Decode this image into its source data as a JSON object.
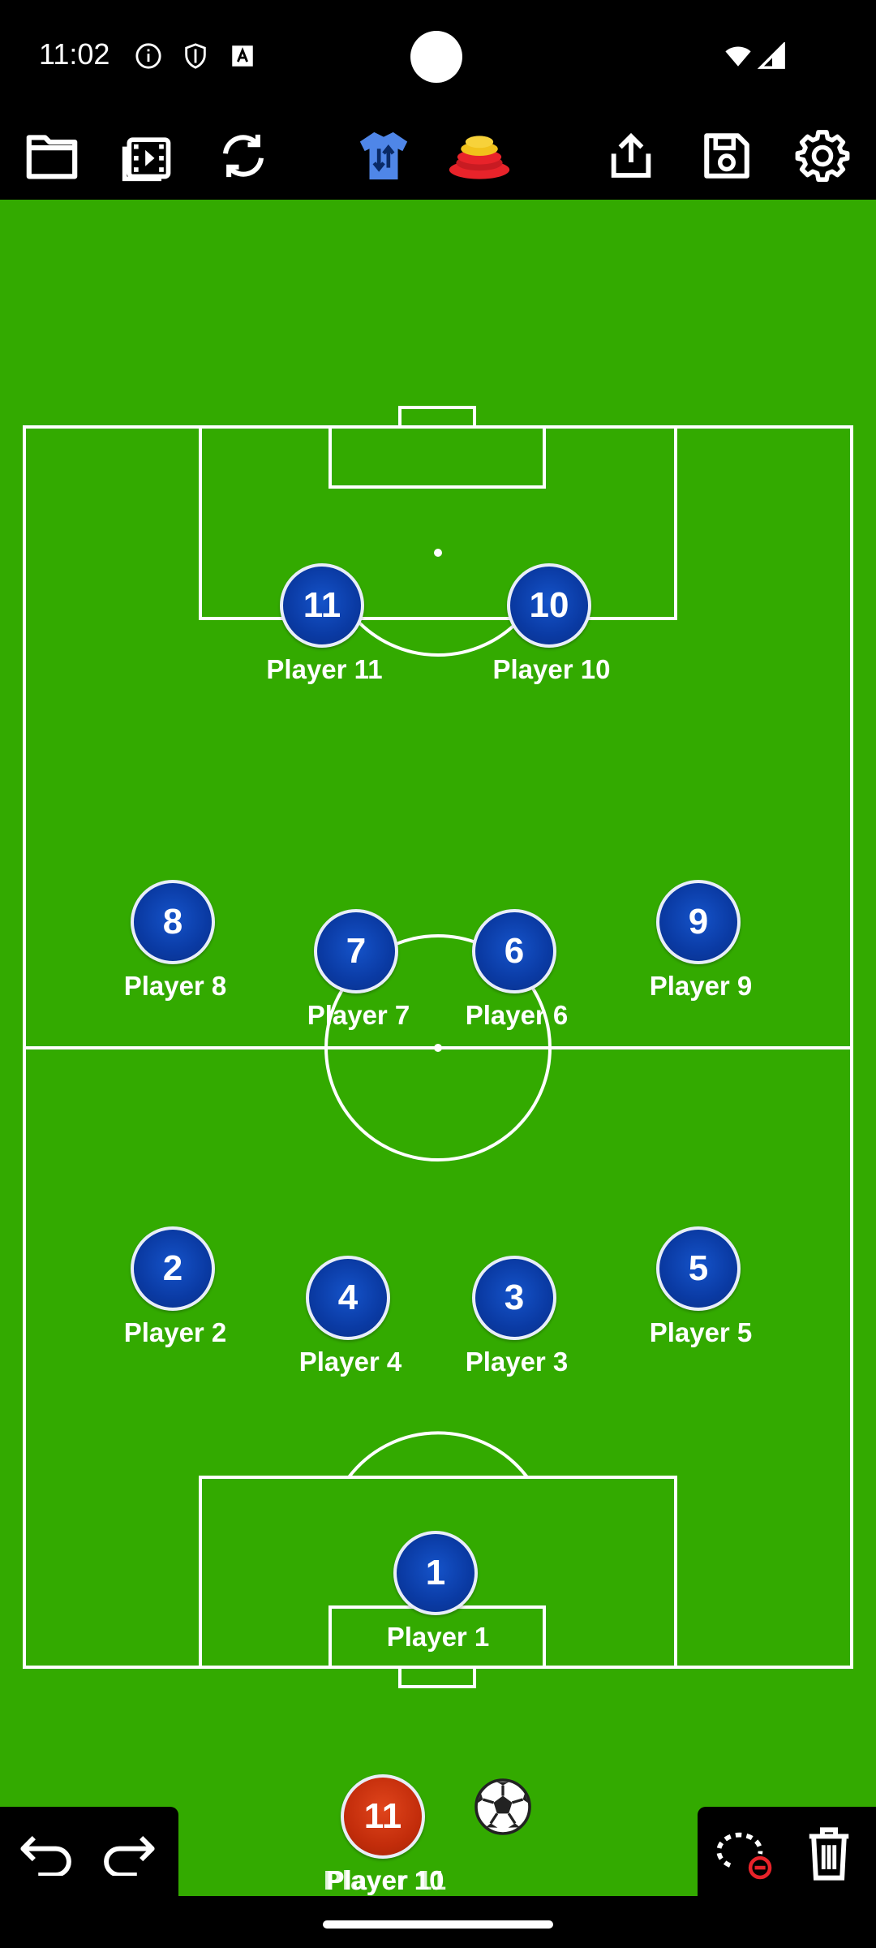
{
  "status_bar": {
    "time": "11:02",
    "icons": [
      "info-icon",
      "shield-icon",
      "keyboard-a-icon",
      "wifi-icon",
      "signal-icon"
    ]
  },
  "toolbar": {
    "buttons": [
      "folder-icon",
      "video-playlist-icon",
      "rotate-icon",
      "shirt-swap-icon",
      "cones-icon",
      "share-icon",
      "save-icon",
      "settings-icon"
    ],
    "shirt_color": "#4f86e8",
    "cone_colors": [
      "#e8232a",
      "#f1c21b"
    ]
  },
  "colors": {
    "field": "#33aa00",
    "lines": "#ffffff",
    "team_disc": "#0a3aa3",
    "reserve_disc": "#c32d0b"
  },
  "players": [
    {
      "number": "11",
      "name": "Player 11"
    },
    {
      "number": "10",
      "name": "Player 10"
    },
    {
      "number": "8",
      "name": "Player 8"
    },
    {
      "number": "7",
      "name": "Player 7"
    },
    {
      "number": "6",
      "name": "Player 6"
    },
    {
      "number": "9",
      "name": "Player 9"
    },
    {
      "number": "2",
      "name": "Player 2"
    },
    {
      "number": "4",
      "name": "Player 4"
    },
    {
      "number": "3",
      "name": "Player 3"
    },
    {
      "number": "5",
      "name": "Player 5"
    },
    {
      "number": "1",
      "name": "Player 1"
    }
  ],
  "reserve": {
    "number": "11",
    "name": "Player 10",
    "name_overlap": "Player 11"
  },
  "bottom_bar": {
    "left": [
      "undo-icon",
      "redo-icon"
    ],
    "right": [
      "lasso-remove-icon",
      "trash-icon"
    ],
    "remove_accent": "#e8232a"
  }
}
